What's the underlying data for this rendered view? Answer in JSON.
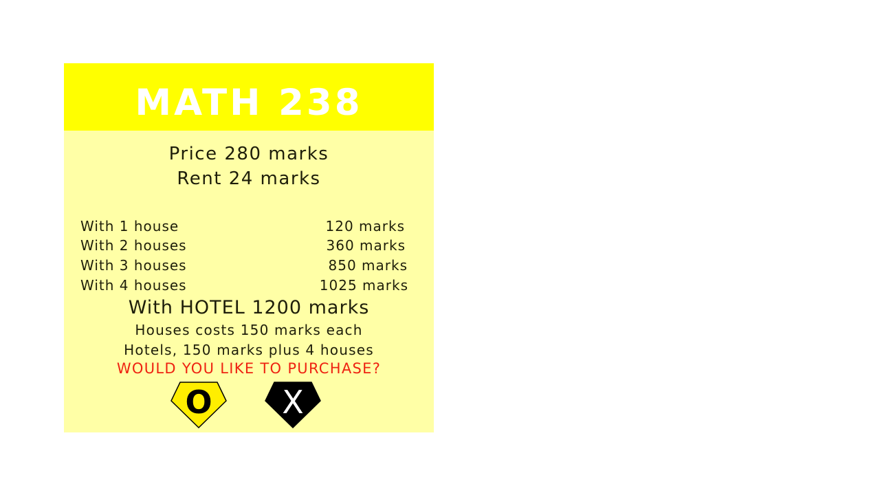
{
  "card": {
    "title": "MATH 238",
    "price": "Price 280 marks",
    "rent": "Rent 24 marks",
    "rent_table": [
      {
        "label": "With 1 house",
        "amount": "120 marks"
      },
      {
        "label": "With 2 houses",
        "amount": "360 marks"
      },
      {
        "label": "With 3 houses",
        "amount": "850 marks"
      },
      {
        "label": "With 4 houses",
        "amount": "1025 marks"
      }
    ],
    "hotel_rent": "With HOTEL 1200 marks",
    "house_cost": "Houses costs 150 marks each",
    "hotel_cost": "Hotels, 150 marks plus 4 houses",
    "prompt": "WOULD YOU LIKE TO PURCHASE?"
  },
  "buttons": {
    "yes_label": "O",
    "no_label": "X"
  },
  "colors": {
    "header": "#ffff00",
    "card_body": "#ffffa6",
    "prompt": "#ee2211",
    "yes_button": "#ffee00",
    "no_button": "#000000"
  }
}
